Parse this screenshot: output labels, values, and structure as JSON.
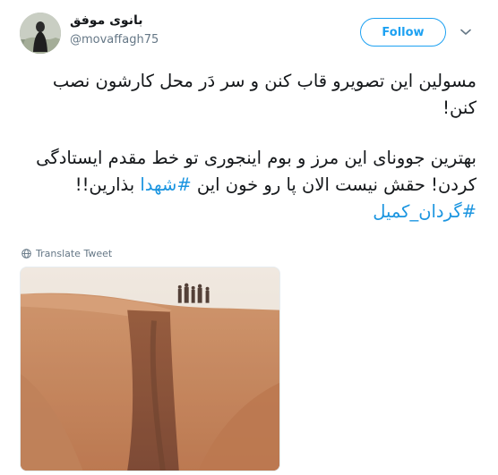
{
  "author": {
    "display_name": "بانوی موفق",
    "handle": "@movaffagh75",
    "avatar_icon": "profile-photo"
  },
  "actions": {
    "follow_label": "Follow",
    "menu_icon": "chevron-down-icon"
  },
  "tweet": {
    "paragraph_1": "مسولین این تصویرو قاب کنن و سر دَر محل کارشون نصب کنن!",
    "paragraph_2_before": "بهترین جوونای این مرز و بوم اینجوری تو خط مقدم ایستادگی کردن! حقش نیست الان پا رو خون این ",
    "paragraph_2_hashtag": "#شهدا",
    "paragraph_2_after": " بذارین!!",
    "hashtag_line": "#گردان_کمیل"
  },
  "translate": {
    "label": "Translate Tweet",
    "icon": "globe-icon"
  },
  "colors": {
    "link": "#1b95e0",
    "follow": "#1da1f2",
    "muted": "#657786",
    "text": "#14171a",
    "border": "#e6ecf0"
  }
}
